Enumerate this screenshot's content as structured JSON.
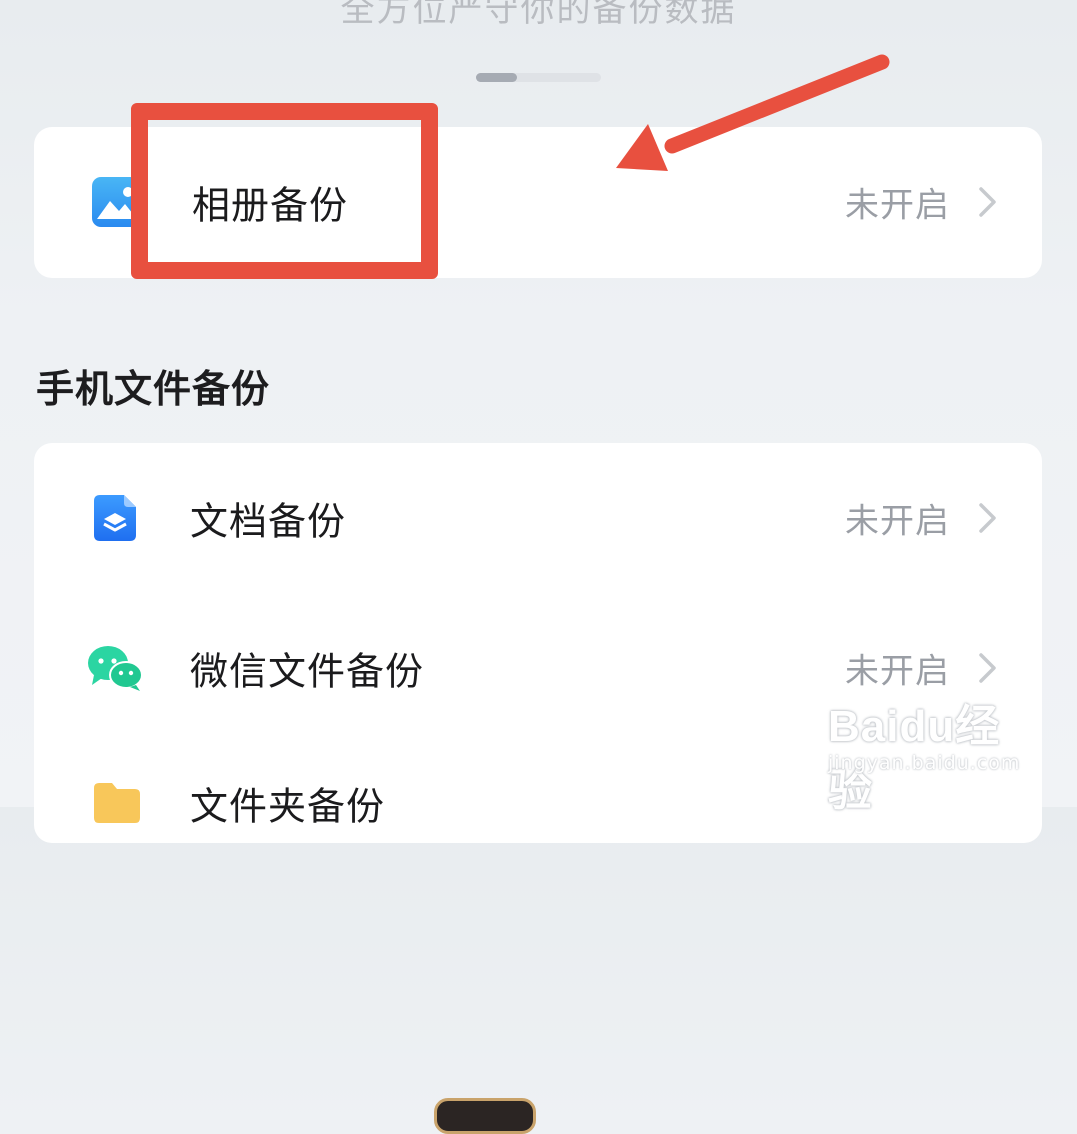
{
  "header": {
    "subtitle": "全方位严守你的备份数据"
  },
  "album_backup": {
    "label": "相册备份",
    "status": "未开启",
    "icon": "photo-album-icon"
  },
  "phone_files_section": {
    "title": "手机文件备份",
    "items": [
      {
        "label": "文档备份",
        "status": "未开启",
        "icon": "document-icon"
      },
      {
        "label": "微信文件备份",
        "status": "未开启",
        "icon": "wechat-icon"
      },
      {
        "label": "文件夹备份",
        "status": "",
        "icon": "folder-icon"
      }
    ]
  },
  "annotation": {
    "box_color": "#e8503f",
    "arrow_color": "#e8503f"
  },
  "watermark": {
    "brand": "Baidu经验",
    "url": "jingyan.baidu.com"
  }
}
